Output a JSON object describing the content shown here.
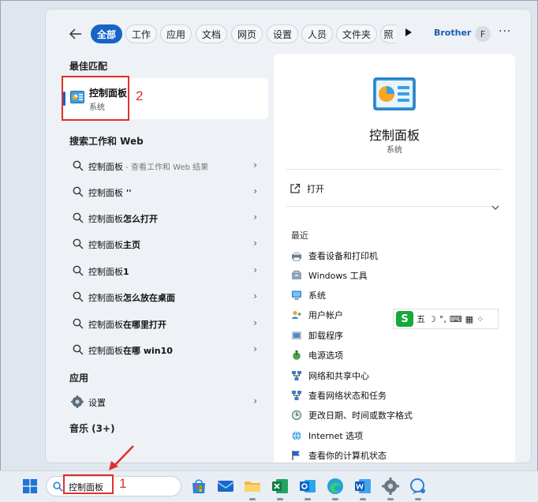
{
  "tabs": [
    {
      "label": "全部",
      "active": true
    },
    {
      "label": "工作"
    },
    {
      "label": "应用"
    },
    {
      "label": "文档"
    },
    {
      "label": "网页"
    },
    {
      "label": "设置"
    },
    {
      "label": "人员"
    },
    {
      "label": "文件夹"
    },
    {
      "label": "照"
    }
  ],
  "header": {
    "account": "Brother",
    "avatar_initial": "F",
    "overflow": "···"
  },
  "best_match": {
    "section_title": "最佳匹配",
    "title": "控制面板",
    "subtitle": "系统"
  },
  "web_search": {
    "section_title": "搜索工作和 Web",
    "results": [
      {
        "bold": "控制面板",
        "rest": "",
        "suffix": " - 查看工作和 Web 结果"
      },
      {
        "bold": "控制面板",
        "rest": " ''",
        "suffix": ""
      },
      {
        "bold": "控制面板",
        "rest": "怎么打开",
        "suffix": ""
      },
      {
        "bold": "控制面板",
        "rest": "主页",
        "suffix": ""
      },
      {
        "bold": "控制面板",
        "rest": "1",
        "suffix": ""
      },
      {
        "bold": "控制面板",
        "rest": "怎么放在桌面",
        "suffix": ""
      },
      {
        "bold": "控制面板",
        "rest": "在哪里打开",
        "suffix": ""
      },
      {
        "bold": "控制面板",
        "rest": "在哪 win10",
        "suffix": ""
      }
    ]
  },
  "apps": {
    "section_title": "应用",
    "item_label": "设置"
  },
  "music": {
    "section_title": "音乐 (3+)"
  },
  "detail": {
    "title": "控制面板",
    "subtitle": "系统",
    "open_label": "打开",
    "recent_title": "最近",
    "recent": [
      "查看设备和打印机",
      "Windows 工具",
      "系统",
      "用户帐户",
      "卸载程序",
      "电源选项",
      "网络和共享中心",
      "查看网络状态和任务",
      "更改日期、时间或数字格式",
      "Internet 选项",
      "查看你的计算机状态"
    ]
  },
  "ime": {
    "logo": "S",
    "mode": "五",
    "extra": "°,"
  },
  "taskbar": {
    "search_value": "控制面板"
  },
  "annotations": {
    "one": "1",
    "two": "2"
  },
  "colors": {
    "accent": "#1664c8",
    "annotation": "#e0302a"
  }
}
